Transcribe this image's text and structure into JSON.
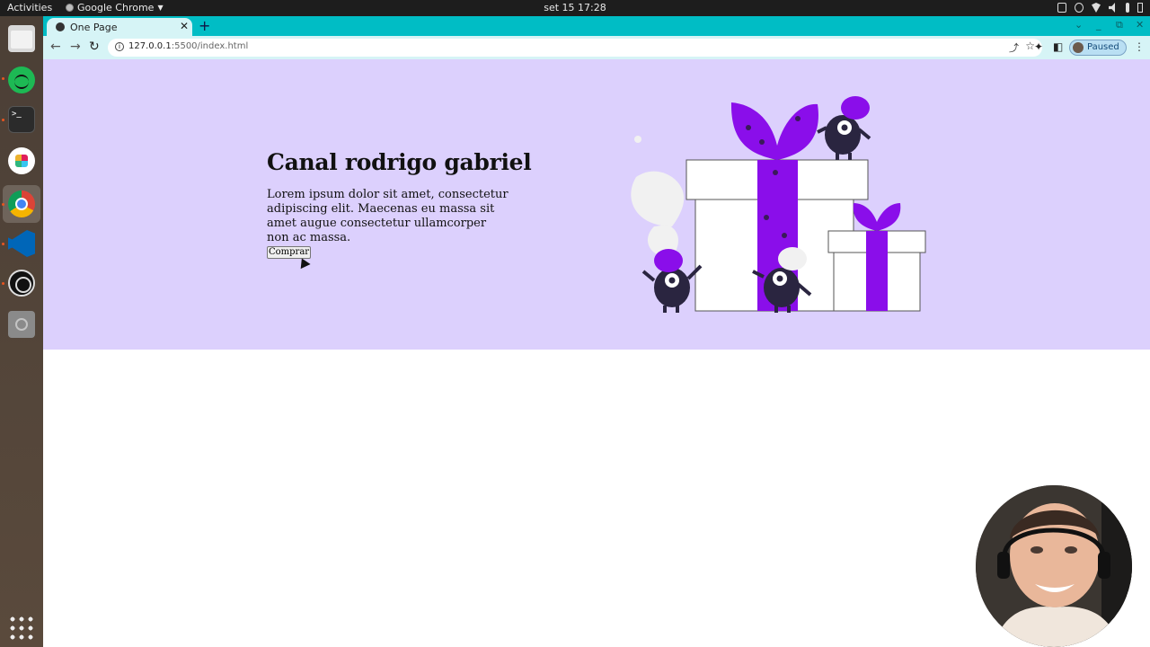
{
  "topbar": {
    "activities": "Activities",
    "app_name": "Google Chrome",
    "clock": "set 15  17:28"
  },
  "dock": {
    "items": [
      "files-icon",
      "spotify-icon",
      "terminal-icon",
      "slack-icon",
      "chrome-icon",
      "vscode-icon",
      "obs-icon",
      "disc-icon",
      "apps-grid-icon"
    ],
    "terminal_glyph": ">_"
  },
  "browser": {
    "tab_title": "One Page",
    "url_host": "127.0.0.1",
    "url_rest": ":5500/index.html",
    "profile_status": "Paused",
    "tabstrip_color": "#00bdc5",
    "toolbar_color": "#d6f4f6"
  },
  "page": {
    "hero_bg": "#dcd0fd",
    "title": "Canal rodrigo gabriel",
    "paragraph": "Lorem ipsum dolor sit amet, consectetur adipiscing elit. Maecenas eu massa sit amet augue consectetur ullamcorper non ac massa.",
    "button_label": "Comprar",
    "accent_color": "#8a0eea"
  }
}
